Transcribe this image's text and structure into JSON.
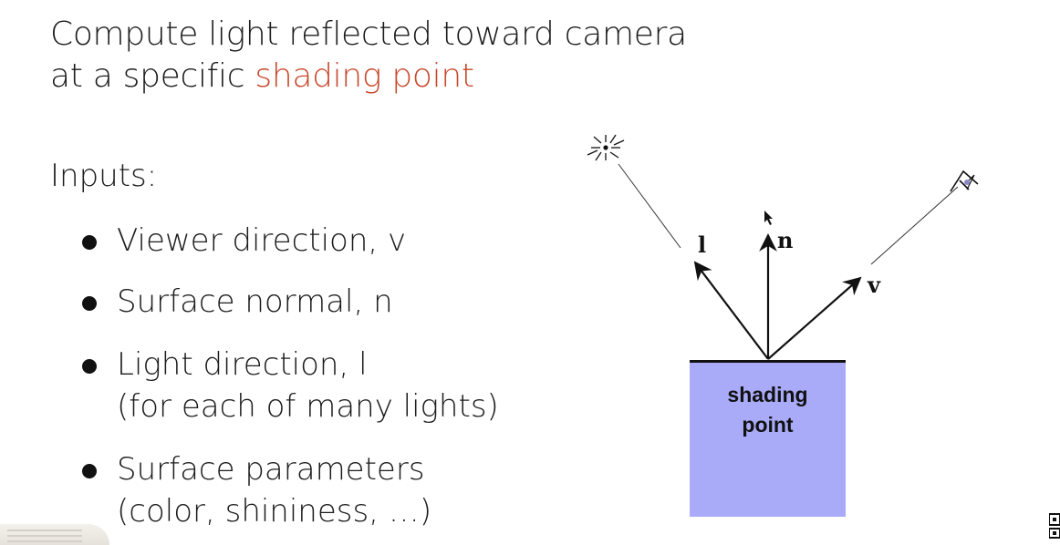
{
  "title": {
    "line1": "Compute light reflected toward camera",
    "line2_prefix": "at a specific ",
    "line2_highlight": "shading point"
  },
  "inputs": {
    "heading": "Inputs:",
    "items": [
      {
        "text": "Viewer direction, v"
      },
      {
        "text": "Surface normal, n"
      },
      {
        "text": "Light direction, l",
        "sub": "(for each of many lights)"
      },
      {
        "text": "Surface parameters",
        "sub": "(color, shininess, …)"
      }
    ]
  },
  "diagram": {
    "labels": {
      "light": "l",
      "normal": "n",
      "viewer": "v"
    },
    "box_label": "shading\npoint",
    "box_color": "#a9aaf8",
    "light_source_icon": "light-burst-icon",
    "camera_icon": "eye-icon"
  },
  "colors": {
    "accent": "#c8482b",
    "text": "#1c1c1c"
  }
}
